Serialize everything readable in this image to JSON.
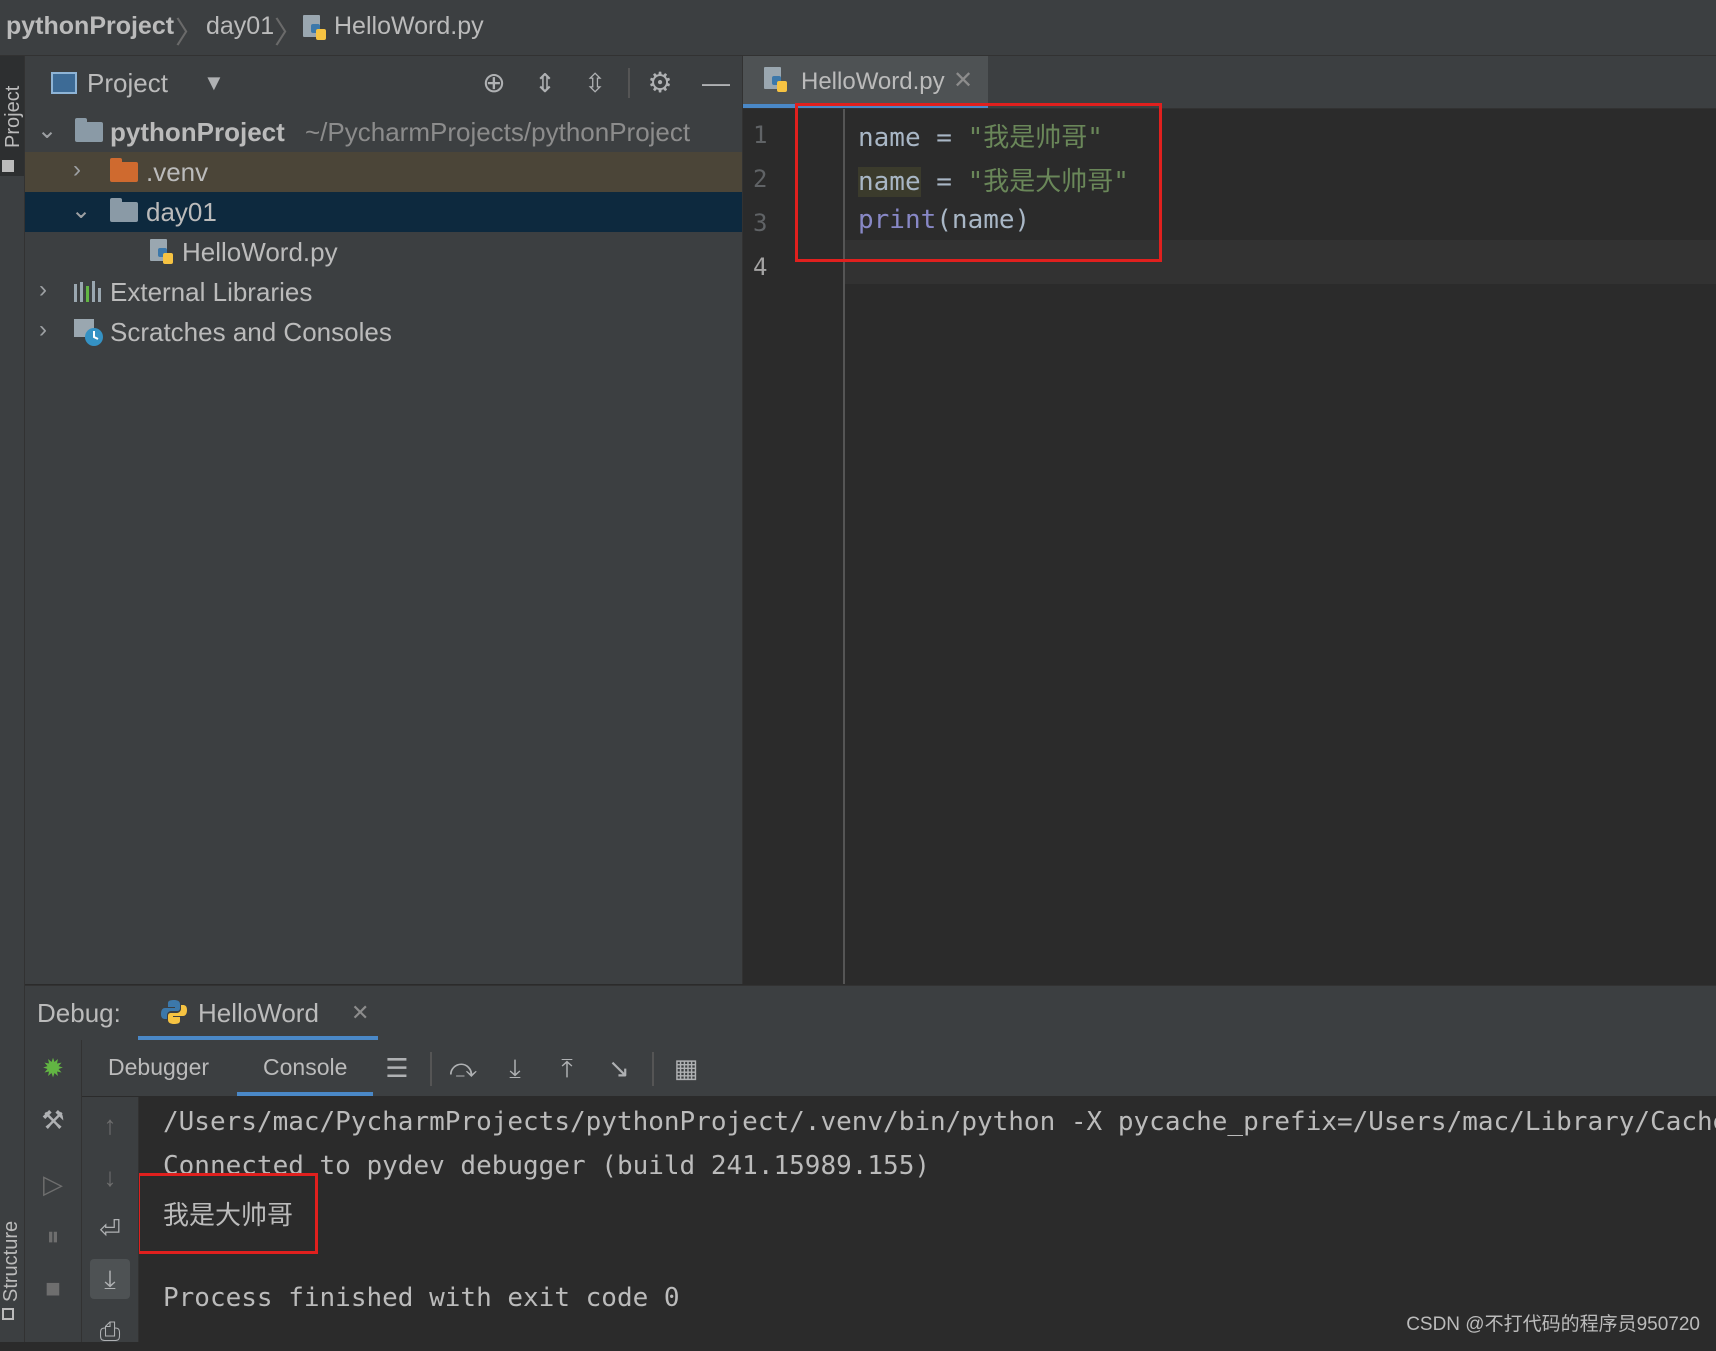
{
  "breadcrumb": {
    "project": "pythonProject",
    "folder": "day01",
    "file": "HelloWord.py"
  },
  "left_stripe": {
    "project_tab": "Project",
    "structure_tab": "Structure"
  },
  "project_panel": {
    "title": "Project",
    "tree": {
      "root_name": "pythonProject",
      "root_path": "~/PycharmProjects/pythonProject",
      "venv": ".venv",
      "day01": "day01",
      "file": "HelloWord.py",
      "external_libraries": "External Libraries",
      "scratches": "Scratches and Consoles"
    }
  },
  "editor": {
    "tab_label": "HelloWord.py",
    "line_numbers": [
      "1",
      "2",
      "3",
      "4"
    ],
    "code": {
      "line1_var": "name",
      "line1_op": " = ",
      "line1_str": "\"我是帅哥\"",
      "line2_var": "name",
      "line2_op": " = ",
      "line2_str": "\"我是大帅哥\"",
      "line3_fn": "print",
      "line3_args": "(name)"
    }
  },
  "debug": {
    "label": "Debug:",
    "run_tab": "HelloWord",
    "tabs": [
      "Debugger",
      "Console"
    ],
    "console_lines": [
      "/Users/mac/PycharmProjects/pythonProject/.venv/bin/python -X pycache_prefix=/Users/mac/Library/Caches",
      "Connected to pydev debugger (build 241.15989.155)",
      "我是大帅哥",
      "",
      "Process finished with exit code 0"
    ]
  },
  "watermark": "CSDN @不打代码的程序员950720",
  "colors": {
    "highlight_box": "#e0201e",
    "string": "#6a8759",
    "builtin": "#8888c6",
    "selection": "#0d293e",
    "venv_row": "#4b4538"
  }
}
